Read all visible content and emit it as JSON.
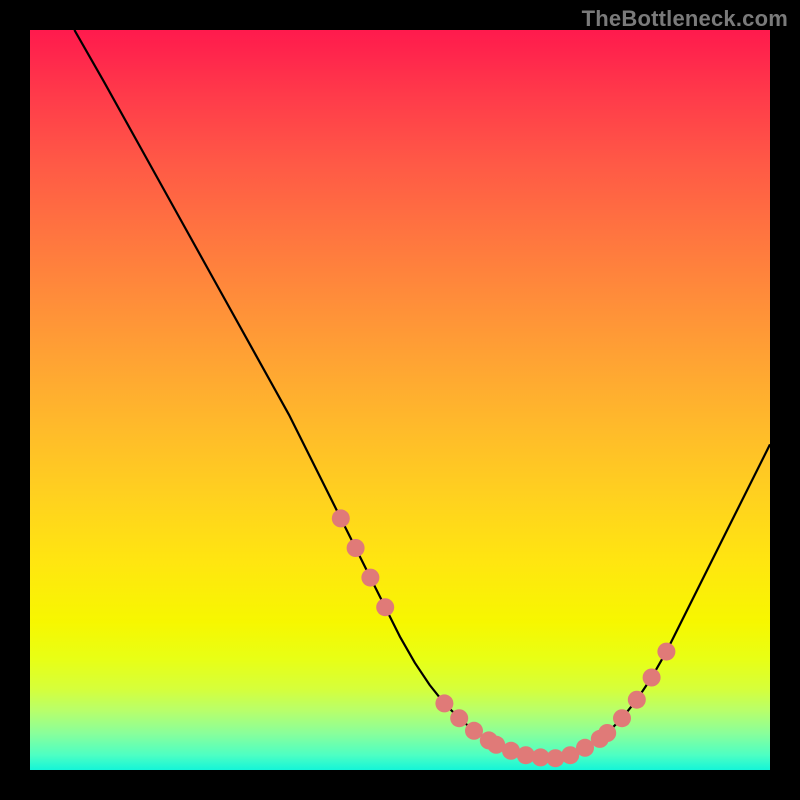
{
  "watermark": "TheBottleneck.com",
  "colors": {
    "background": "#000000",
    "curve": "#000000",
    "dot": "#e07a78"
  },
  "chart_data": {
    "type": "line",
    "title": "",
    "xlabel": "",
    "ylabel": "",
    "xlim": [
      0,
      100
    ],
    "ylim": [
      0,
      100
    ],
    "grid": false,
    "legend": false,
    "series": [
      {
        "name": "bottleneck-curve",
        "x": [
          6,
          10,
          15,
          20,
          25,
          30,
          35,
          40,
          42,
          44,
          46,
          48,
          50,
          52,
          54,
          56,
          58,
          60,
          62,
          64,
          66,
          68,
          70,
          72,
          74,
          76,
          78,
          80,
          82,
          84,
          86,
          88,
          90,
          95,
          100
        ],
        "y": [
          100,
          93,
          84,
          75,
          66,
          57,
          48,
          38,
          34,
          30,
          26,
          22,
          18,
          14.5,
          11.5,
          9,
          7,
          5.3,
          4,
          3,
          2.2,
          1.8,
          1.6,
          1.8,
          2.4,
          3.5,
          5,
          7,
          9.5,
          12.5,
          16,
          20,
          24,
          34,
          44
        ]
      }
    ],
    "markers": {
      "name": "highlight-dots",
      "x": [
        42,
        44,
        46,
        48,
        56,
        58,
        60,
        62,
        63,
        65,
        67,
        69,
        71,
        73,
        75,
        77,
        78,
        80,
        82,
        84,
        86
      ],
      "y": [
        34,
        30,
        26,
        22,
        9,
        7,
        5.3,
        4,
        3.4,
        2.6,
        2,
        1.7,
        1.6,
        2,
        3,
        4.2,
        5,
        7,
        9.5,
        12.5,
        16
      ]
    },
    "background_gradient": {
      "type": "vertical",
      "stops": [
        {
          "pos": 0.0,
          "color": "#ff1a4d"
        },
        {
          "pos": 0.45,
          "color": "#ffa433"
        },
        {
          "pos": 0.72,
          "color": "#ffe610"
        },
        {
          "pos": 0.85,
          "color": "#e8ff15"
        },
        {
          "pos": 0.95,
          "color": "#8aff9a"
        },
        {
          "pos": 1.0,
          "color": "#14f5d8"
        }
      ]
    }
  }
}
